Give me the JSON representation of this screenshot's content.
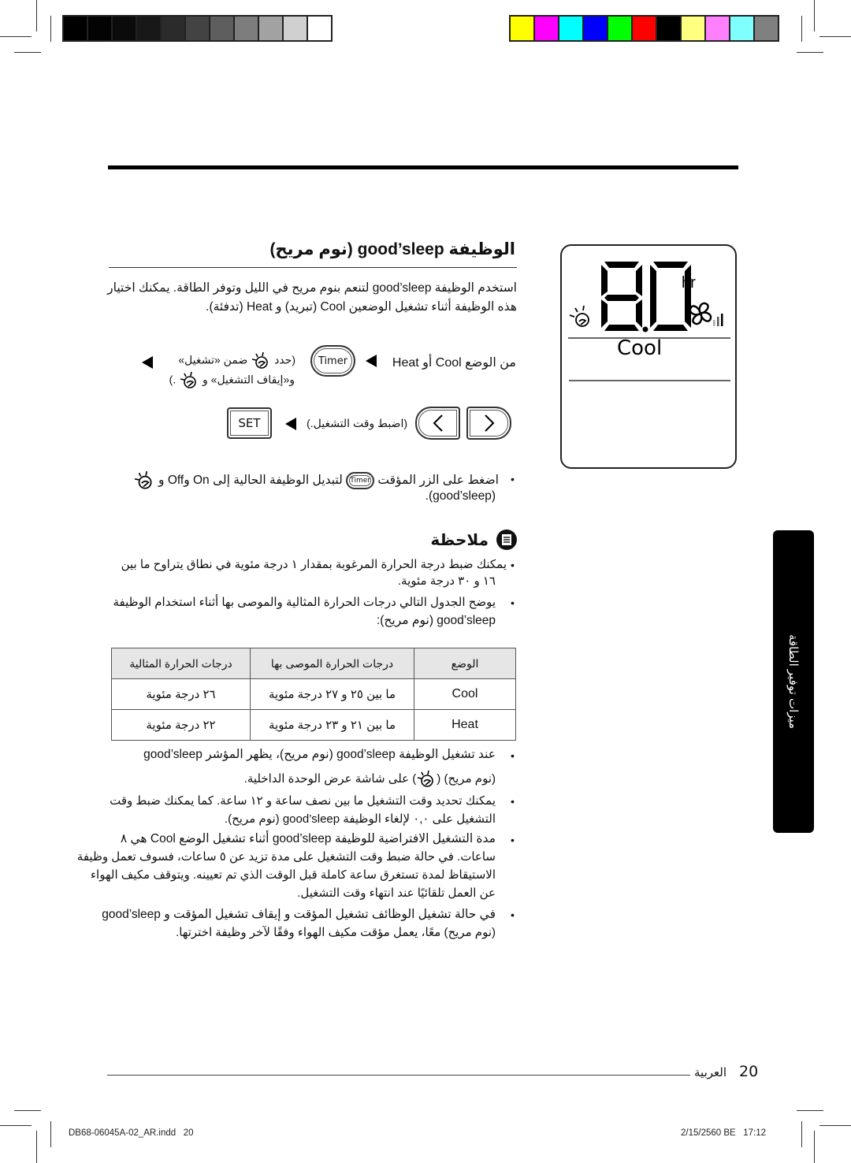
{
  "color_bars": {
    "grayscale": [
      "#000000",
      "#030303",
      "#0b0b0b",
      "#181818",
      "#2b2b2b",
      "#434343",
      "#5e5e5e",
      "#7d7d7d",
      "#a2a2a2",
      "#d0d0d0",
      "#ffffff"
    ],
    "color": [
      "#ffff00",
      "#ff00ff",
      "#00ffff",
      "#0000ff",
      "#00ff00",
      "#ff0000",
      "#000000",
      "#ffff80",
      "#ff80ff",
      "#80ffff",
      "#808080"
    ]
  },
  "section": {
    "title": "الوظيفة good’sleep (نوم مريح)",
    "intro": "استخدم الوظيفة good’sleep لتنعم بنوم مريح في الليل وتوفر الطاقة. يمكنك اختيار هذه الوظيفة أثناء تشغيل الوضعين Cool (تبريد) و Heat (تدفئة)."
  },
  "remote_display": {
    "digits": "8.0",
    "unit": "hr",
    "mode": "Cool",
    "icons": [
      "good-sleep-icon",
      "fan-icon",
      "fan-speed-bars-icon"
    ]
  },
  "steps": {
    "step1_prefix": "من الوضع Cool أو Heat",
    "timer_label": "Timer",
    "step1_select_a": "(حدد",
    "step1_select_b": "ضمن «تشغيل»",
    "step1_select_c": "و«إيقاف التشغيل» و",
    "step1_select_d": ".)",
    "step2_text": "(اضبط وقت التشغيل.)",
    "set_label": "SET"
  },
  "press_note": {
    "line1_a": "اضغط على الزر المؤقت",
    "line1_b": "لتبديل الوظيفة الحالية إلى On وOff و",
    "line2": "(good’sleep)."
  },
  "note": {
    "heading": "ملاحظة",
    "bullets": [
      {
        "line1": "يمكنك ضبط درجة الحرارة المرغوبة بمقدار ١ درجة مئوية في نطاق يتراوح ما بين",
        "line2": "١٦ و ٣٠ درجة مئوية."
      },
      {
        "line1": "يوضح الجدول التالي درجات الحرارة المثالية والموصى بها أثناء استخدام الوظيفة",
        "line2": "good’sleep (نوم مريح):"
      }
    ]
  },
  "table": {
    "headers": [
      "الوضع",
      "درجات الحرارة الموصى بها",
      "درجات الحرارة المثالية"
    ],
    "rows": [
      [
        "Cool",
        "ما بين ٢٥ و ٢٧ درجة مئوية",
        "٢٦ درجة مئوية"
      ],
      [
        "Heat",
        "ما بين ٢١ و ٢٣ درجة مئوية",
        "٢٢ درجة مئوية"
      ]
    ]
  },
  "more_bullets": [
    {
      "lines": [
        "عند تشغيل الوظيفة good’sleep (نوم مريح)، يظهر المؤشر good’sleep",
        "(نوم مريح) (",
        ") على شاشة عرض الوحدة الداخلية."
      ]
    },
    {
      "lines": [
        "يمكنك تحديد وقت التشغيل ما بين نصف ساعة و ١٢ ساعة. كما يمكنك ضبط وقت",
        "التشغيل على ٠,٠ لإلغاء الوظيفة good’sleep (نوم مريح)."
      ]
    },
    {
      "lines": [
        "مدة التشغيل الافتراضية للوظيفة good’sleep أثناء تشغيل الوضع Cool هي ٨",
        "ساعات. في حالة ضبط وقت التشغيل على مدة تزيد عن ٥ ساعات، فسوف تعمل وظيفة",
        "الاستيقاظ لمدة تستغرق ساعة كاملة قبل الوقت الذي تم تعيينه. ويتوقف مكيف الهواء",
        "عن العمل تلقائيًا عند انتهاء وقت التشغيل."
      ]
    },
    {
      "lines": [
        "في حالة تشغيل الوظائف تشغيل المؤقت و إيقاف تشغيل المؤقت و good’sleep",
        "(نوم مريح) معًا، يعمل مؤقت مكيف الهواء وفقًا لآخر وظيفة اخترتها."
      ]
    }
  ],
  "side_tab": {
    "label": "ميزات توفير الطاقة"
  },
  "footer": {
    "page_number": "20",
    "language": "العربية",
    "file_slug": "DB68-06045A-02_AR.indd   20",
    "timestamp": "2/15/2560 BE   17:12"
  }
}
